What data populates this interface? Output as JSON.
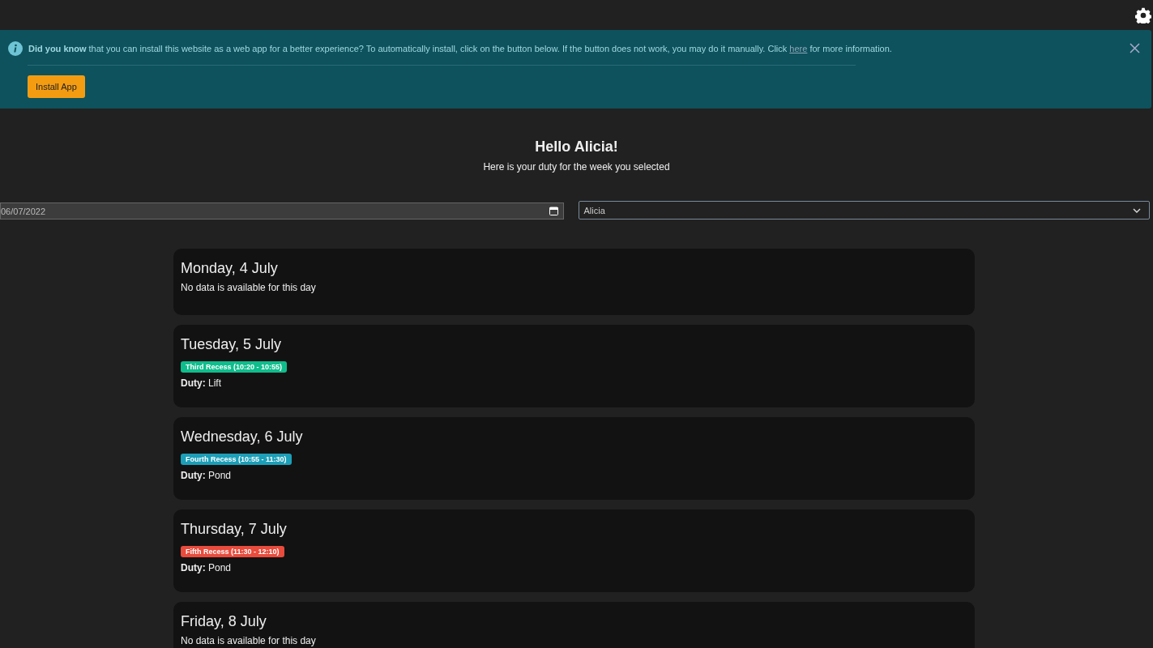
{
  "banner": {
    "message_start": "**Did you know** that you can install this website as a web app for a better experience? To automatically install, click on the button below. If the button does not work, you may do it manually. Click",
    "link": "here",
    "message_end": "for more information.",
    "button": "Install App"
  },
  "greeting": {
    "title": "Hello Alicia!",
    "subtitle": "Here is your duty for the week you selected"
  },
  "filters": {
    "date": "06/07/2022",
    "person": "Alicia"
  },
  "days": [
    {
      "title": "Monday, 4 July",
      "kind": "empty",
      "note": "No data is available for this day"
    },
    {
      "title": "Tuesday, 5 July",
      "kind": "duty",
      "recess": "Third Recess (10:20 - 10:55)",
      "color": "#0fbd8c",
      "duty_label": "Duty:",
      "duty": "Lift"
    },
    {
      "title": "Wednesday, 6 July",
      "kind": "duty",
      "recess": "Fourth Recess (10:55 - 11:30)",
      "color": "#1c9fb8",
      "duty_label": "Duty:",
      "duty": "Pond"
    },
    {
      "title": "Thursday, 7 July",
      "kind": "duty",
      "recess": "Fifth Recess (11:30 - 12:10)",
      "color": "#e94b3c",
      "duty_label": "Duty:",
      "duty": "Pond"
    },
    {
      "title": "Friday, 8 July",
      "kind": "empty",
      "note": "No data is available for this day"
    }
  ]
}
